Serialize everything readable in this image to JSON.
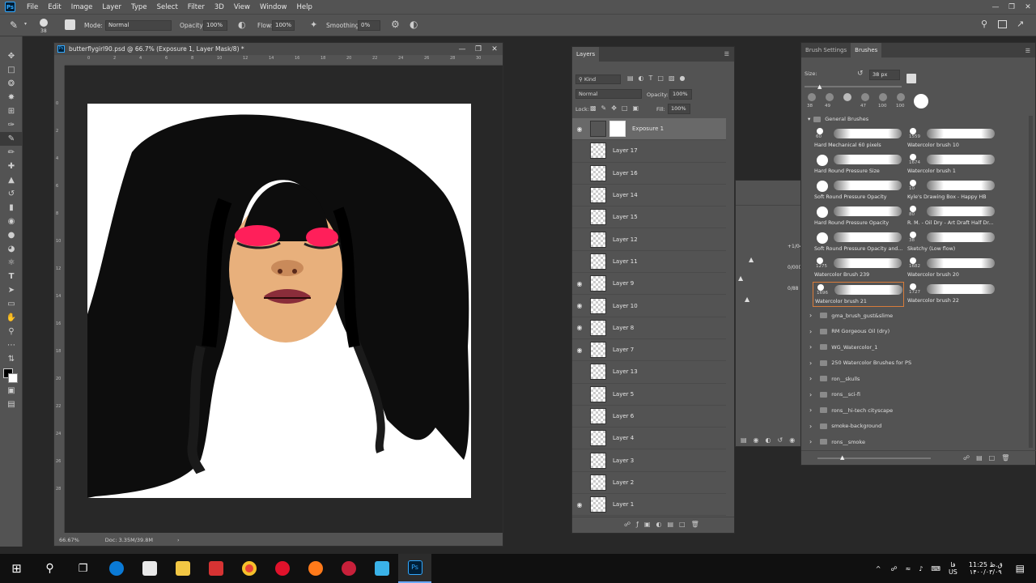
{
  "app": {
    "logo": "Ps",
    "brand_color": "#31a8ff"
  },
  "menu": [
    "File",
    "Edit",
    "Image",
    "Layer",
    "Type",
    "Select",
    "Filter",
    "3D",
    "View",
    "Window",
    "Help"
  ],
  "options": {
    "brush_size": "38",
    "mode_label": "Mode:",
    "mode_value": "Normal",
    "opacity_label": "Opacity:",
    "opacity_value": "100%",
    "flow_label": "Flow:",
    "flow_value": "100%",
    "smoothing_label": "Smoothing:",
    "smoothing_value": "0%"
  },
  "document": {
    "title": "butterflygirl90.psd @ 66.7% (Exposure 1, Layer Mask/8) *",
    "zoom": "66.67%",
    "doc_size": "Doc: 3.35M/39.8M",
    "ruler_h": [
      "0",
      "2",
      "4",
      "6",
      "8",
      "10",
      "12",
      "14",
      "16",
      "18",
      "20",
      "22",
      "24",
      "26",
      "28",
      "30"
    ],
    "ruler_v": [
      "0",
      "2",
      "4",
      "6",
      "8",
      "10",
      "12",
      "14",
      "16",
      "18",
      "20",
      "22",
      "24",
      "26",
      "28"
    ]
  },
  "layers_panel": {
    "tab": "Layers",
    "kind_label": "Kind",
    "blend_mode": "Normal",
    "opacity_label": "Opacity:",
    "opacity_value": "100%",
    "lock_label": "Lock:",
    "fill_label": "Fill:",
    "fill_value": "100%",
    "layers": [
      {
        "name": "Exposure 1",
        "visible": true,
        "selected": true
      },
      {
        "name": "Layer 17",
        "visible": false
      },
      {
        "name": "Layer 16",
        "visible": false
      },
      {
        "name": "Layer 14",
        "visible": false
      },
      {
        "name": "Layer 15",
        "visible": false
      },
      {
        "name": "Layer 12",
        "visible": false
      },
      {
        "name": "Layer 11",
        "visible": false
      },
      {
        "name": "Layer 9",
        "visible": true
      },
      {
        "name": "Layer 10",
        "visible": true
      },
      {
        "name": "Layer 8",
        "visible": true
      },
      {
        "name": "Layer 7",
        "visible": true
      },
      {
        "name": "Layer 13",
        "visible": false
      },
      {
        "name": "Layer 5",
        "visible": false
      },
      {
        "name": "Layer 6",
        "visible": false
      },
      {
        "name": "Layer 4",
        "visible": false
      },
      {
        "name": "Layer 3",
        "visible": false
      },
      {
        "name": "Layer 2",
        "visible": false
      },
      {
        "name": "Layer 1",
        "visible": true
      }
    ]
  },
  "bg_panel": {
    "values": [
      "+1/04",
      "0/000",
      "0/88"
    ]
  },
  "brushes_panel": {
    "tabs": [
      "Brush Settings",
      "Brushes"
    ],
    "size_label": "Size:",
    "size_value": "38 px",
    "presets": [
      "38",
      "49",
      "",
      "47",
      "100",
      "100"
    ],
    "group": "General Brushes",
    "brushes": [
      {
        "num": "60",
        "name": "Hard Mechanical 60 pixels"
      },
      {
        "num": "1559",
        "name": "Watercolor brush 10"
      },
      {
        "num": "",
        "name": "Hard Round Pressure Size"
      },
      {
        "num": "1674",
        "name": "Watercolor brush 1"
      },
      {
        "num": "",
        "name": "Soft Round Pressure Opacity"
      },
      {
        "num": "10",
        "name": "Kyle's Drawing Box - Happy HB"
      },
      {
        "num": "",
        "name": "Hard Round Pressure Opacity"
      },
      {
        "num": "80",
        "name": "R. M. - Oil Dry - Art Draft Half Dr..."
      },
      {
        "num": "",
        "name": "Soft Round Pressure Opacity and..."
      },
      {
        "num": "38",
        "name": "Sketchy (Low flow)"
      },
      {
        "num": "1275",
        "name": "Watercolor Brush 239"
      },
      {
        "num": "1682",
        "name": "Watercolor brush 20"
      },
      {
        "num": "1696",
        "name": "Watercolor brush 21"
      },
      {
        "num": "1727",
        "name": "Watercolor brush 22"
      }
    ],
    "folders": [
      "gma_brush_gust&slime",
      "RM Gorgeous Oil (dry)",
      "WG_Watercolor_1",
      "250 Watercolor Brushes for PS",
      "ron__skulls",
      "rons__sci-fi",
      "rons__hi-tech cityscape",
      "smoke-background",
      "rons__smoke"
    ]
  },
  "taskbar": {
    "time": "11:25 ق.ظ",
    "date": "۱۴۰۰/۰۳/۰۹",
    "lang_top": "فا",
    "lang": "US"
  }
}
